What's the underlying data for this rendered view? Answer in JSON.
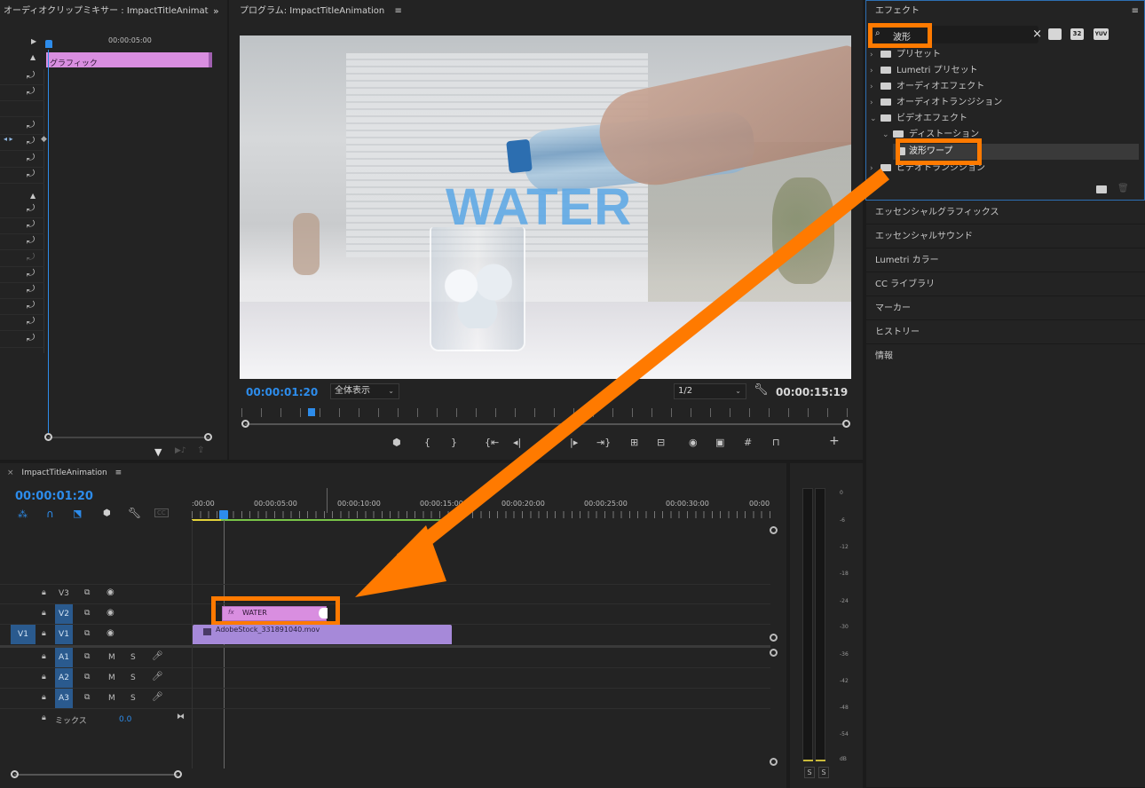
{
  "mixer": {
    "title": "オーディオクリップミキサー : ImpactTitleAnimat",
    "expand": "»",
    "timecode": "00:00:05:00",
    "clip_label": "グラフィック",
    "undo_glyph": "⤾"
  },
  "program": {
    "title": "プログラム: ImpactTitleAnimation",
    "menu_icon": "≡",
    "video_text": "WATER",
    "timecode": "00:00:01:20",
    "zoom": "全体表示",
    "resolution": "1/2",
    "duration": "00:00:15:19",
    "playhead_fraction": 0.11
  },
  "effects": {
    "title": "エフェクト",
    "search_value": "波形",
    "clear": "×",
    "badges": [
      "32",
      "YUV"
    ],
    "tree": [
      {
        "label": "プリセット",
        "chev": "›"
      },
      {
        "label": "Lumetri プリセット",
        "chev": "›"
      },
      {
        "label": "オーディオエフェクト",
        "chev": "›"
      },
      {
        "label": "オーディオトランジション",
        "chev": "›"
      },
      {
        "label": "ビデオエフェクト",
        "chev": "⌄"
      },
      {
        "label": "ディストーション",
        "chev": "⌄"
      },
      {
        "label": "波形ワープ",
        "chev": ""
      },
      {
        "label": "ビデオトランジション",
        "chev": "›"
      }
    ]
  },
  "side_panels": [
    "エッセンシャルグラフィックス",
    "エッセンシャルサウンド",
    "Lumetri カラー",
    "CC ライブラリ",
    "マーカー",
    "ヒストリー",
    "情報"
  ],
  "timeline": {
    "close": "×",
    "title": "ImpactTitleAnimation",
    "menu": "≡",
    "timecode": "00:00:01:20",
    "cc": "CC",
    "ruler": [
      ":00:00",
      "00:00:05:00",
      "00:00:10:00",
      "00:00:15:00",
      "00:00:20:00",
      "00:00:25:00",
      "00:00:30:00",
      "00:00"
    ],
    "tracks": {
      "v3": "V3",
      "v2": "V2",
      "v1": "V1",
      "v1_src": "V1",
      "a1": "A1",
      "a2": "A2",
      "a3": "A3",
      "m": "M",
      "s": "S",
      "mix_label": "ミックス",
      "mix_value": "0.0"
    },
    "clips": {
      "title_clip": "WATER",
      "fx": "fx",
      "video_clip": "AdobeStock_331891040.mov"
    }
  },
  "meter": {
    "scale": [
      "0",
      "-6",
      "-12",
      "-18",
      "-24",
      "-30",
      "-36",
      "-42",
      "-48",
      "-54",
      "dB"
    ],
    "solo": [
      "S",
      "S"
    ]
  },
  "colors": {
    "accent_blue": "#2d8ceb",
    "highlight_orange": "#ff7a00",
    "clip_pink": "#d98ee0",
    "clip_purple": "#a689d9"
  }
}
